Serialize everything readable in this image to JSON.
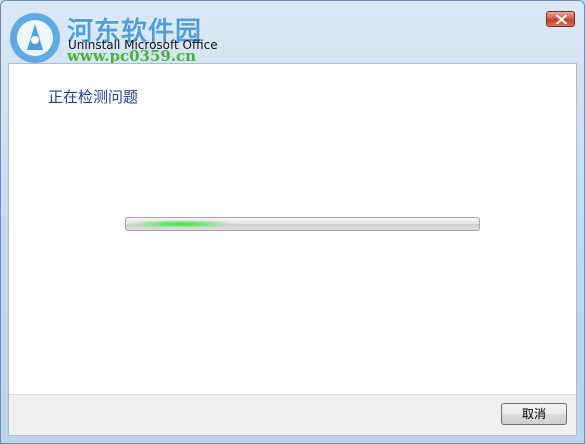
{
  "watermark": {
    "name": "河东软件园",
    "url": "www.pc0359.cn",
    "logo_icon": "hedong-logo-icon"
  },
  "window": {
    "title": "Uninstall Microsoft Office",
    "close_icon": "close-icon"
  },
  "main": {
    "heading": "正在检测问题",
    "progress": {
      "style": "indeterminate",
      "color": "#3ddc3d"
    }
  },
  "footer": {
    "cancel_label": "取消"
  },
  "colors": {
    "frame": "#c3d8ee",
    "heading": "#1a3f9b",
    "close_button": "#c0402c"
  }
}
